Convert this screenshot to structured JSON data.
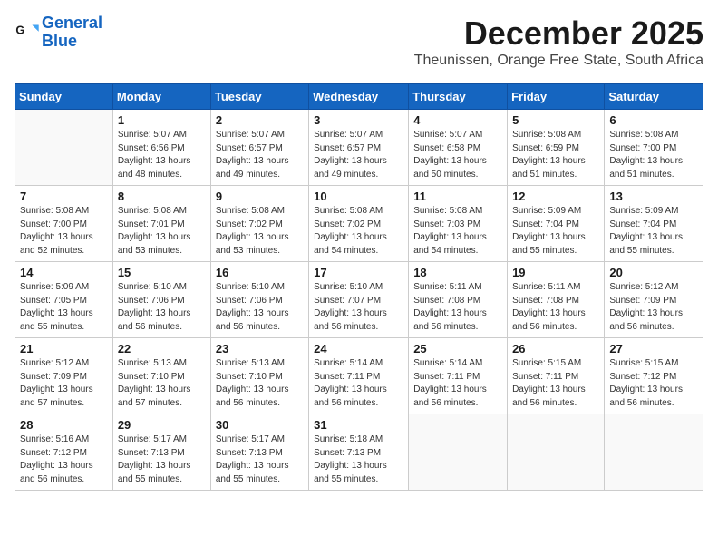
{
  "logo": {
    "line1": "General",
    "line2": "Blue"
  },
  "title": "December 2025",
  "location": "Theunissen, Orange Free State, South Africa",
  "days_header": [
    "Sunday",
    "Monday",
    "Tuesday",
    "Wednesday",
    "Thursday",
    "Friday",
    "Saturday"
  ],
  "weeks": [
    [
      {
        "day": "",
        "info": ""
      },
      {
        "day": "1",
        "info": "Sunrise: 5:07 AM\nSunset: 6:56 PM\nDaylight: 13 hours\nand 48 minutes."
      },
      {
        "day": "2",
        "info": "Sunrise: 5:07 AM\nSunset: 6:57 PM\nDaylight: 13 hours\nand 49 minutes."
      },
      {
        "day": "3",
        "info": "Sunrise: 5:07 AM\nSunset: 6:57 PM\nDaylight: 13 hours\nand 49 minutes."
      },
      {
        "day": "4",
        "info": "Sunrise: 5:07 AM\nSunset: 6:58 PM\nDaylight: 13 hours\nand 50 minutes."
      },
      {
        "day": "5",
        "info": "Sunrise: 5:08 AM\nSunset: 6:59 PM\nDaylight: 13 hours\nand 51 minutes."
      },
      {
        "day": "6",
        "info": "Sunrise: 5:08 AM\nSunset: 7:00 PM\nDaylight: 13 hours\nand 51 minutes."
      }
    ],
    [
      {
        "day": "7",
        "info": "Sunrise: 5:08 AM\nSunset: 7:00 PM\nDaylight: 13 hours\nand 52 minutes."
      },
      {
        "day": "8",
        "info": "Sunrise: 5:08 AM\nSunset: 7:01 PM\nDaylight: 13 hours\nand 53 minutes."
      },
      {
        "day": "9",
        "info": "Sunrise: 5:08 AM\nSunset: 7:02 PM\nDaylight: 13 hours\nand 53 minutes."
      },
      {
        "day": "10",
        "info": "Sunrise: 5:08 AM\nSunset: 7:02 PM\nDaylight: 13 hours\nand 54 minutes."
      },
      {
        "day": "11",
        "info": "Sunrise: 5:08 AM\nSunset: 7:03 PM\nDaylight: 13 hours\nand 54 minutes."
      },
      {
        "day": "12",
        "info": "Sunrise: 5:09 AM\nSunset: 7:04 PM\nDaylight: 13 hours\nand 55 minutes."
      },
      {
        "day": "13",
        "info": "Sunrise: 5:09 AM\nSunset: 7:04 PM\nDaylight: 13 hours\nand 55 minutes."
      }
    ],
    [
      {
        "day": "14",
        "info": "Sunrise: 5:09 AM\nSunset: 7:05 PM\nDaylight: 13 hours\nand 55 minutes."
      },
      {
        "day": "15",
        "info": "Sunrise: 5:10 AM\nSunset: 7:06 PM\nDaylight: 13 hours\nand 56 minutes."
      },
      {
        "day": "16",
        "info": "Sunrise: 5:10 AM\nSunset: 7:06 PM\nDaylight: 13 hours\nand 56 minutes."
      },
      {
        "day": "17",
        "info": "Sunrise: 5:10 AM\nSunset: 7:07 PM\nDaylight: 13 hours\nand 56 minutes."
      },
      {
        "day": "18",
        "info": "Sunrise: 5:11 AM\nSunset: 7:08 PM\nDaylight: 13 hours\nand 56 minutes."
      },
      {
        "day": "19",
        "info": "Sunrise: 5:11 AM\nSunset: 7:08 PM\nDaylight: 13 hours\nand 56 minutes."
      },
      {
        "day": "20",
        "info": "Sunrise: 5:12 AM\nSunset: 7:09 PM\nDaylight: 13 hours\nand 56 minutes."
      }
    ],
    [
      {
        "day": "21",
        "info": "Sunrise: 5:12 AM\nSunset: 7:09 PM\nDaylight: 13 hours\nand 57 minutes."
      },
      {
        "day": "22",
        "info": "Sunrise: 5:13 AM\nSunset: 7:10 PM\nDaylight: 13 hours\nand 57 minutes."
      },
      {
        "day": "23",
        "info": "Sunrise: 5:13 AM\nSunset: 7:10 PM\nDaylight: 13 hours\nand 56 minutes."
      },
      {
        "day": "24",
        "info": "Sunrise: 5:14 AM\nSunset: 7:11 PM\nDaylight: 13 hours\nand 56 minutes."
      },
      {
        "day": "25",
        "info": "Sunrise: 5:14 AM\nSunset: 7:11 PM\nDaylight: 13 hours\nand 56 minutes."
      },
      {
        "day": "26",
        "info": "Sunrise: 5:15 AM\nSunset: 7:11 PM\nDaylight: 13 hours\nand 56 minutes."
      },
      {
        "day": "27",
        "info": "Sunrise: 5:15 AM\nSunset: 7:12 PM\nDaylight: 13 hours\nand 56 minutes."
      }
    ],
    [
      {
        "day": "28",
        "info": "Sunrise: 5:16 AM\nSunset: 7:12 PM\nDaylight: 13 hours\nand 56 minutes."
      },
      {
        "day": "29",
        "info": "Sunrise: 5:17 AM\nSunset: 7:13 PM\nDaylight: 13 hours\nand 55 minutes."
      },
      {
        "day": "30",
        "info": "Sunrise: 5:17 AM\nSunset: 7:13 PM\nDaylight: 13 hours\nand 55 minutes."
      },
      {
        "day": "31",
        "info": "Sunrise: 5:18 AM\nSunset: 7:13 PM\nDaylight: 13 hours\nand 55 minutes."
      },
      {
        "day": "",
        "info": ""
      },
      {
        "day": "",
        "info": ""
      },
      {
        "day": "",
        "info": ""
      }
    ]
  ]
}
